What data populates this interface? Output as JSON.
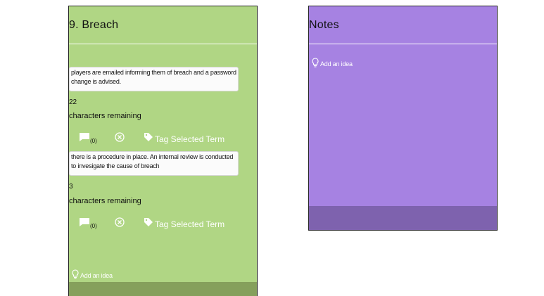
{
  "breach": {
    "title": "9. Breach",
    "entries": [
      {
        "text": "players are emailed informing them of breach and a password change is advised.",
        "chars_left": "22",
        "chars_label": "characters remaining",
        "comment_count": "(0)",
        "tag_label": "Tag Selected Term"
      },
      {
        "text": "there is a procedure in place. An internal review is conducted to invesigate the cause of breach",
        "chars_left": "3",
        "chars_label": "characters remaining",
        "comment_count": "(0)",
        "tag_label": "Tag Selected Term"
      }
    ],
    "add_idea": "Add an idea"
  },
  "notes": {
    "title": "Notes",
    "add_idea": "Add an idea"
  },
  "colors": {
    "breach_bg": "#b0d684",
    "breach_footer": "#85a05c",
    "notes_bg": "#a682e2",
    "notes_footer": "#7e62ae"
  },
  "icons": [
    "comment-icon",
    "cancel-icon",
    "tag-icon",
    "lightbulb-icon"
  ]
}
